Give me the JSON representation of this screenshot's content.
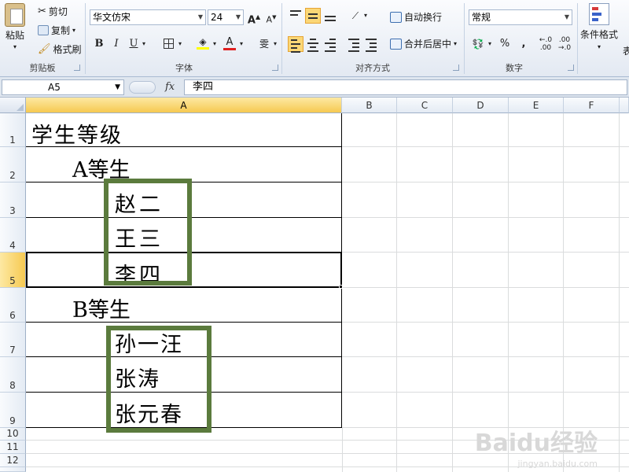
{
  "ribbon": {
    "clipboard": {
      "paste_label": "粘贴",
      "cut_label": "剪切",
      "copy_label": "复制",
      "format_painter_label": "格式刷",
      "group_label": "剪贴板"
    },
    "font": {
      "font_name": "华文仿宋",
      "font_size": "24",
      "bold": "B",
      "italic": "I",
      "underline": "U",
      "group_label": "字体"
    },
    "alignment": {
      "wrap_text_label": "自动换行",
      "merge_center_label": "合并后居中",
      "group_label": "对齐方式"
    },
    "number": {
      "format_value": "常规",
      "percent": "%",
      "comma": ",",
      "group_label": "数字"
    },
    "styles": {
      "conditional_format_label": "条件格式",
      "overflow_label": "表"
    }
  },
  "formula_bar": {
    "name_box": "A5",
    "fx_label": "fx",
    "content": "李四"
  },
  "columns": [
    "A",
    "B",
    "C",
    "D",
    "E",
    "F"
  ],
  "rows": [
    "1",
    "2",
    "3",
    "4",
    "5",
    "6",
    "7",
    "8",
    "9",
    "10",
    "11",
    "12"
  ],
  "cells": {
    "a1": "学生等级",
    "a2": "A等生",
    "a3": "赵二",
    "a4": "王三",
    "a5": "李四",
    "a6": "B等生",
    "a7": "孙一汪",
    "a8": "张涛",
    "a9": "张元春"
  },
  "selection": {
    "active_cell": "A5"
  },
  "watermark": {
    "main": "Baidu经验",
    "sub": "jingyan.baidu.com"
  },
  "colors": {
    "highlight_box": "#5b7b3d",
    "selected_header": "#f6c951"
  }
}
